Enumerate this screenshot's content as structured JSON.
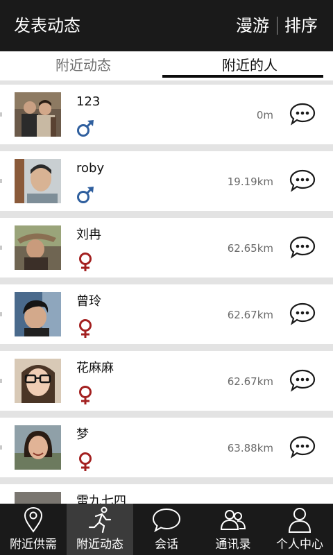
{
  "header": {
    "title": "发表动态",
    "roam": "漫游",
    "sort": "排序"
  },
  "tabs": [
    {
      "label": "附近动态"
    },
    {
      "label": "附近的人"
    }
  ],
  "people": [
    {
      "name": "123",
      "distance": "0m",
      "gender": "male"
    },
    {
      "name": "roby",
      "distance": "19.19km",
      "gender": "male"
    },
    {
      "name": "刘冉",
      "distance": "62.65km",
      "gender": "female"
    },
    {
      "name": "曾玲",
      "distance": "62.67km",
      "gender": "female"
    },
    {
      "name": "花麻麻",
      "distance": "62.67km",
      "gender": "female"
    },
    {
      "name": "梦",
      "distance": "63.88km",
      "gender": "female"
    },
    {
      "name": "雷九七四"
    }
  ],
  "bottom_nav": [
    {
      "label": "附近供需",
      "icon": "location-pin-icon"
    },
    {
      "label": "附近动态",
      "icon": "running-person-icon"
    },
    {
      "label": "会话",
      "icon": "speech-bubble-icon"
    },
    {
      "label": "通讯录",
      "icon": "contacts-icon"
    },
    {
      "label": "个人中心",
      "icon": "person-icon"
    }
  ],
  "colors": {
    "bar": "#1a1a1a",
    "male": "#2f5f9e",
    "female": "#a32020",
    "active_nav": "#3b3b3b"
  }
}
